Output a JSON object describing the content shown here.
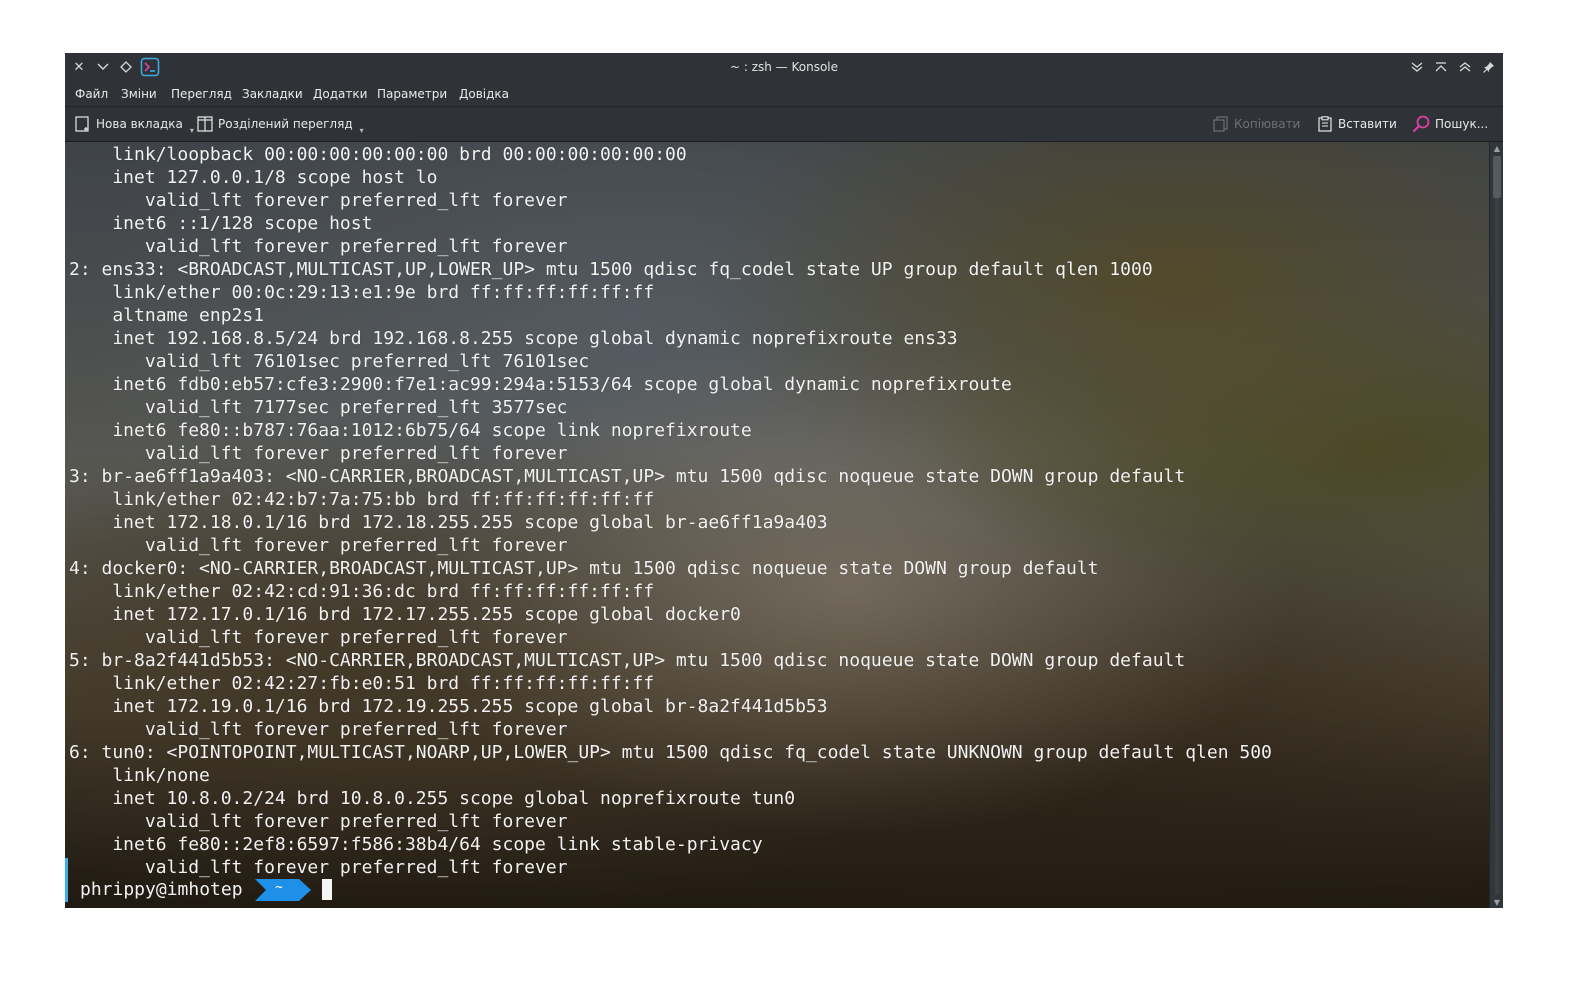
{
  "window": {
    "title": "~ : zsh — Konsole"
  },
  "menu": [
    "Файл",
    "Зміни",
    "Перегляд",
    "Закладки",
    "Додатки",
    "Параметри",
    "Довідка"
  ],
  "toolbar": {
    "new_tab": "Нова вкладка",
    "split_view": "Розділений перегляд",
    "copy": "Копіювати",
    "paste": "Вставити",
    "find": "Пошук..."
  },
  "terminal": {
    "lines": [
      "    link/loopback 00:00:00:00:00:00 brd 00:00:00:00:00:00",
      "    inet 127.0.0.1/8 scope host lo",
      "       valid_lft forever preferred_lft forever",
      "    inet6 ::1/128 scope host",
      "       valid_lft forever preferred_lft forever",
      "2: ens33: <BROADCAST,MULTICAST,UP,LOWER_UP> mtu 1500 qdisc fq_codel state UP group default qlen 1000",
      "    link/ether 00:0c:29:13:e1:9e brd ff:ff:ff:ff:ff:ff",
      "    altname enp2s1",
      "    inet 192.168.8.5/24 brd 192.168.8.255 scope global dynamic noprefixroute ens33",
      "       valid_lft 76101sec preferred_lft 76101sec",
      "    inet6 fdb0:eb57:cfe3:2900:f7e1:ac99:294a:5153/64 scope global dynamic noprefixroute",
      "       valid_lft 7177sec preferred_lft 3577sec",
      "    inet6 fe80::b787:76aa:1012:6b75/64 scope link noprefixroute",
      "       valid_lft forever preferred_lft forever",
      "3: br-ae6ff1a9a403: <NO-CARRIER,BROADCAST,MULTICAST,UP> mtu 1500 qdisc noqueue state DOWN group default",
      "    link/ether 02:42:b7:7a:75:bb brd ff:ff:ff:ff:ff:ff",
      "    inet 172.18.0.1/16 brd 172.18.255.255 scope global br-ae6ff1a9a403",
      "       valid_lft forever preferred_lft forever",
      "4: docker0: <NO-CARRIER,BROADCAST,MULTICAST,UP> mtu 1500 qdisc noqueue state DOWN group default",
      "    link/ether 02:42:cd:91:36:dc brd ff:ff:ff:ff:ff:ff",
      "    inet 172.17.0.1/16 brd 172.17.255.255 scope global docker0",
      "       valid_lft forever preferred_lft forever",
      "5: br-8a2f441d5b53: <NO-CARRIER,BROADCAST,MULTICAST,UP> mtu 1500 qdisc noqueue state DOWN group default",
      "    link/ether 02:42:27:fb:e0:51 brd ff:ff:ff:ff:ff:ff",
      "    inet 172.19.0.1/16 brd 172.19.255.255 scope global br-8a2f441d5b53",
      "       valid_lft forever preferred_lft forever",
      "6: tun0: <POINTOPOINT,MULTICAST,NOARP,UP,LOWER_UP> mtu 1500 qdisc fq_codel state UNKNOWN group default qlen 500",
      "    link/none",
      "    inet 10.8.0.2/24 brd 10.8.0.255 scope global noprefixroute tun0",
      "       valid_lft forever preferred_lft forever",
      "    inet6 fe80::2ef8:6597:f586:38b4/64 scope link stable-privacy",
      "       valid_lft forever preferred_lft forever"
    ],
    "prompt_user": "phrippy@imhotep",
    "prompt_dir": "~",
    "prompt_color": "#1e90e8",
    "accent_color": "#3daee9"
  }
}
